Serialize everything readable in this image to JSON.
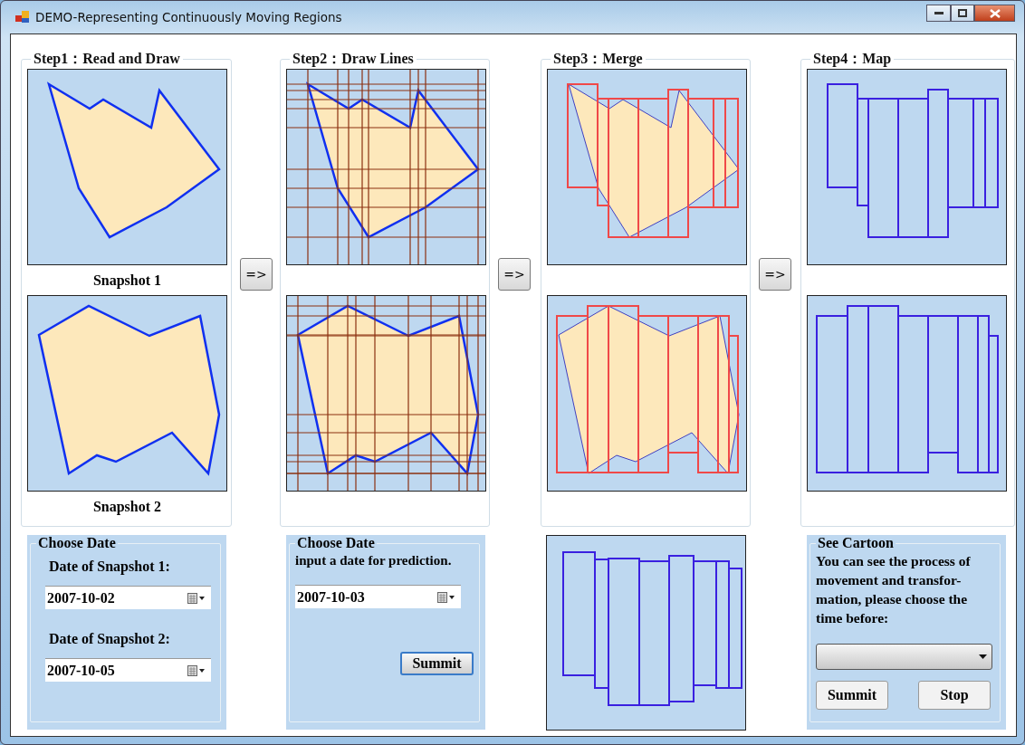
{
  "window": {
    "title": "DEMO-Representing Continuously Moving Regions"
  },
  "steps": [
    {
      "kind": "read",
      "title": "Step1：Read and Draw",
      "captions": [
        "Snapshot 1",
        "Snapshot 2"
      ]
    },
    {
      "kind": "lines",
      "title": "Step2：Draw Lines"
    },
    {
      "kind": "merge",
      "title": "Step3：Merge"
    },
    {
      "kind": "map",
      "title": "Step4：Map"
    }
  ],
  "arrow_buttons": [
    "=>",
    "=>",
    "=>"
  ],
  "choose_dates": {
    "title": "Choose Date",
    "fields": [
      {
        "label": "Date of Snapshot 1:",
        "value": "2007-10-02"
      },
      {
        "label": "Date of Snapshot 2:",
        "value": "2007-10-05"
      }
    ]
  },
  "prediction": {
    "title": "Choose Date",
    "hint": "input a date for prediction.",
    "value": "2007-10-03",
    "button": "Summit"
  },
  "cartoon": {
    "title": "See Cartoon",
    "text": "You can see the process of movement and transfor-mation, please choose the time before:",
    "buttons": [
      "Summit",
      "Stop"
    ]
  }
}
